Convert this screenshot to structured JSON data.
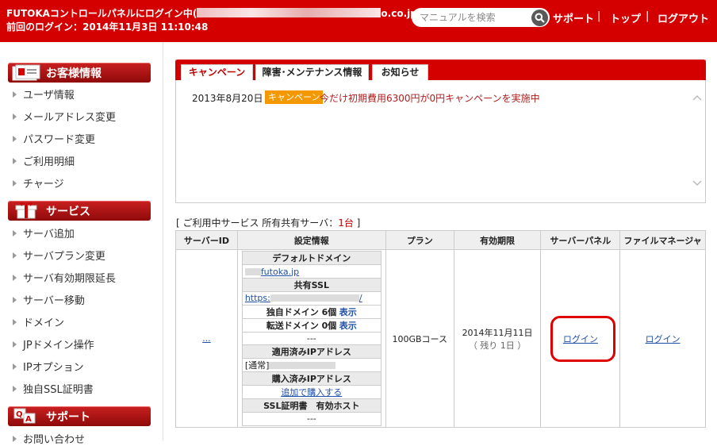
{
  "header": {
    "login_prefix": "FUTOKAコントロールパネルにログイン中(",
    "login_suffix": "o.co.jp)",
    "last_login": "前回のログイン：2014年11月3日 11:10:48",
    "search_placeholder": "マニュアルを検索",
    "nav": [
      "サポート",
      "トップ",
      "ログアウト"
    ],
    "separator": "|",
    "accent": "#d40000"
  },
  "sidebar": {
    "sections": [
      {
        "title": "お客様情報",
        "icon": "customer-card-icon",
        "items": [
          "ユーザ情報",
          "メールアドレス変更",
          "パスワード変更",
          "ご利用明細",
          "チャージ"
        ]
      },
      {
        "title": "サービス",
        "icon": "gift-box-icon",
        "items": [
          "サーバ追加",
          "サーバプラン変更",
          "サーバ有効期限延長",
          "サーバー移動",
          "ドメイン",
          "JPドメイン操作",
          "IPオプション",
          "独自SSL証明書"
        ]
      },
      {
        "title": "サポート",
        "icon": "qa-icon",
        "items": [
          "お問い合わせ"
        ]
      }
    ]
  },
  "notice": {
    "tabs": [
      "キャンペーン",
      "障害･メンテナンス情報",
      "お知らせ"
    ],
    "active_tab": 0,
    "items": [
      {
        "date": "2013年8月20日",
        "badge": "キャンペーン",
        "text": "今だけ初期費用6300円が0円キャンペーンを実施中",
        "badge_color": "#f39800"
      }
    ]
  },
  "services": {
    "caption_prefix": "[ ご利用中サービス 所有共有サーバ：",
    "count": "1台",
    "caption_suffix": " ]",
    "columns": [
      "サーバーID",
      "設定情報",
      "プラン",
      "有効期限",
      "サーバーパネル",
      "ファイルマネージャ"
    ],
    "row": {
      "server_id": "...",
      "settings": {
        "default_domain_label": "デフォルトドメイン",
        "default_domain": "futoka.jp",
        "shared_ssl_label": "共有SSL",
        "shared_ssl_prefix": "https:",
        "shared_ssl_suffix": "/",
        "own_domain_label": "独自ドメイン 6個",
        "own_domain_link": "表示",
        "forward_domain_label": "転送ドメイン 0個",
        "forward_domain_link": "表示",
        "dash": "---",
        "applied_ip_label": "適用済みIPアドレス",
        "applied_ip": "[通常]",
        "purchased_ip_label": "購入済みIPアドレス",
        "purchase_link": "追加で購入する",
        "ssl_cert_label": "SSL証明書　有効ホスト",
        "ssl_cert_value": "---"
      },
      "plan": "100GBコース",
      "expiry_date": "2014年11月11日",
      "expiry_remaining": "（ 残り 1日 ）",
      "server_panel_link": "ログイン",
      "file_manager_link": "ログイン"
    }
  }
}
